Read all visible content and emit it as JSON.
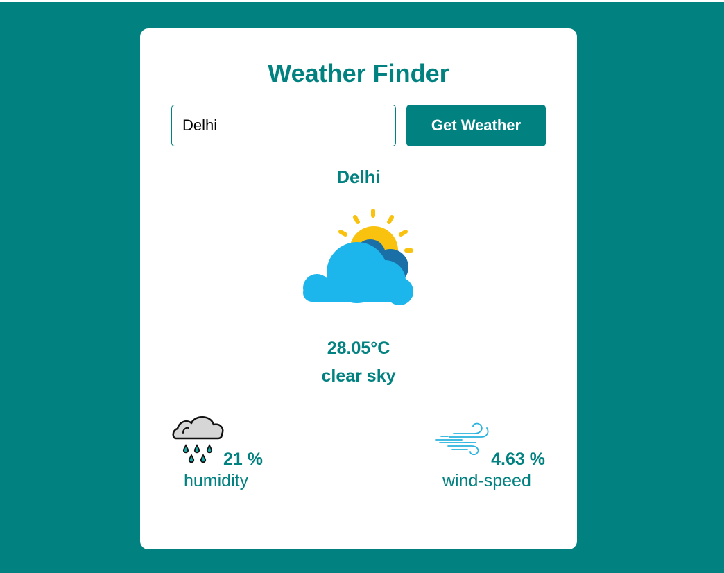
{
  "app": {
    "title": "Weather Finder",
    "colors": {
      "background": "#018180",
      "accent": "#018180",
      "card": "#ffffff"
    }
  },
  "search": {
    "value": "Delhi",
    "button_label": "Get Weather"
  },
  "weather": {
    "city": "Delhi",
    "icon": "partly-cloudy-icon",
    "temperature": "28.05°C",
    "description": "clear sky"
  },
  "stats": {
    "humidity": {
      "icon": "rain-cloud-icon",
      "value": "21 %",
      "label": "humidity"
    },
    "wind": {
      "icon": "wind-icon",
      "value": "4.63 %",
      "label": "wind-speed"
    }
  }
}
